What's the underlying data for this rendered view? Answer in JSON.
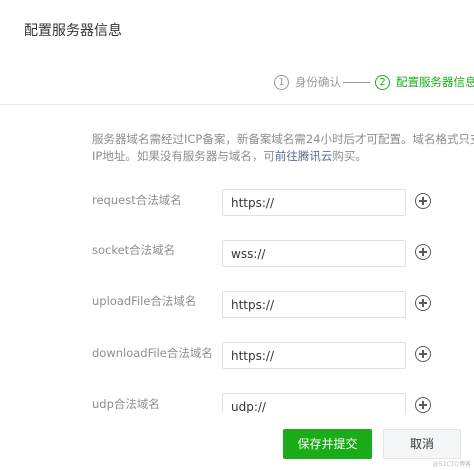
{
  "dialog": {
    "title": "配置服务器信息"
  },
  "steps": [
    {
      "number": "1",
      "label": "身份确认",
      "active": false
    },
    {
      "number": "2",
      "label": "配置服务器信息",
      "active": true
    }
  ],
  "description": {
    "line1": "服务器域名需经过ICP备案，新备案域名需24小时后才可配置。域名格式只支持英",
    "line2_prefix": "IP地址。如果没有服务器与域名，可",
    "line2_link": "前往腾讯云",
    "line2_suffix": "购买。"
  },
  "fields": [
    {
      "label": "request合法域名",
      "value": "https://"
    },
    {
      "label": "socket合法域名",
      "value": "wss://"
    },
    {
      "label": "uploadFile合法域名",
      "value": "https://"
    },
    {
      "label": "downloadFile合法域名",
      "value": "https://"
    },
    {
      "label": "udp合法域名",
      "value": "udp://"
    }
  ],
  "footer": {
    "submit_label": "保存并提交",
    "cancel_label": "取消"
  },
  "watermark": "@51CTO博客",
  "colors": {
    "accent": "#1aad19",
    "link": "#576b95",
    "muted_text": "#8d8d8d"
  }
}
